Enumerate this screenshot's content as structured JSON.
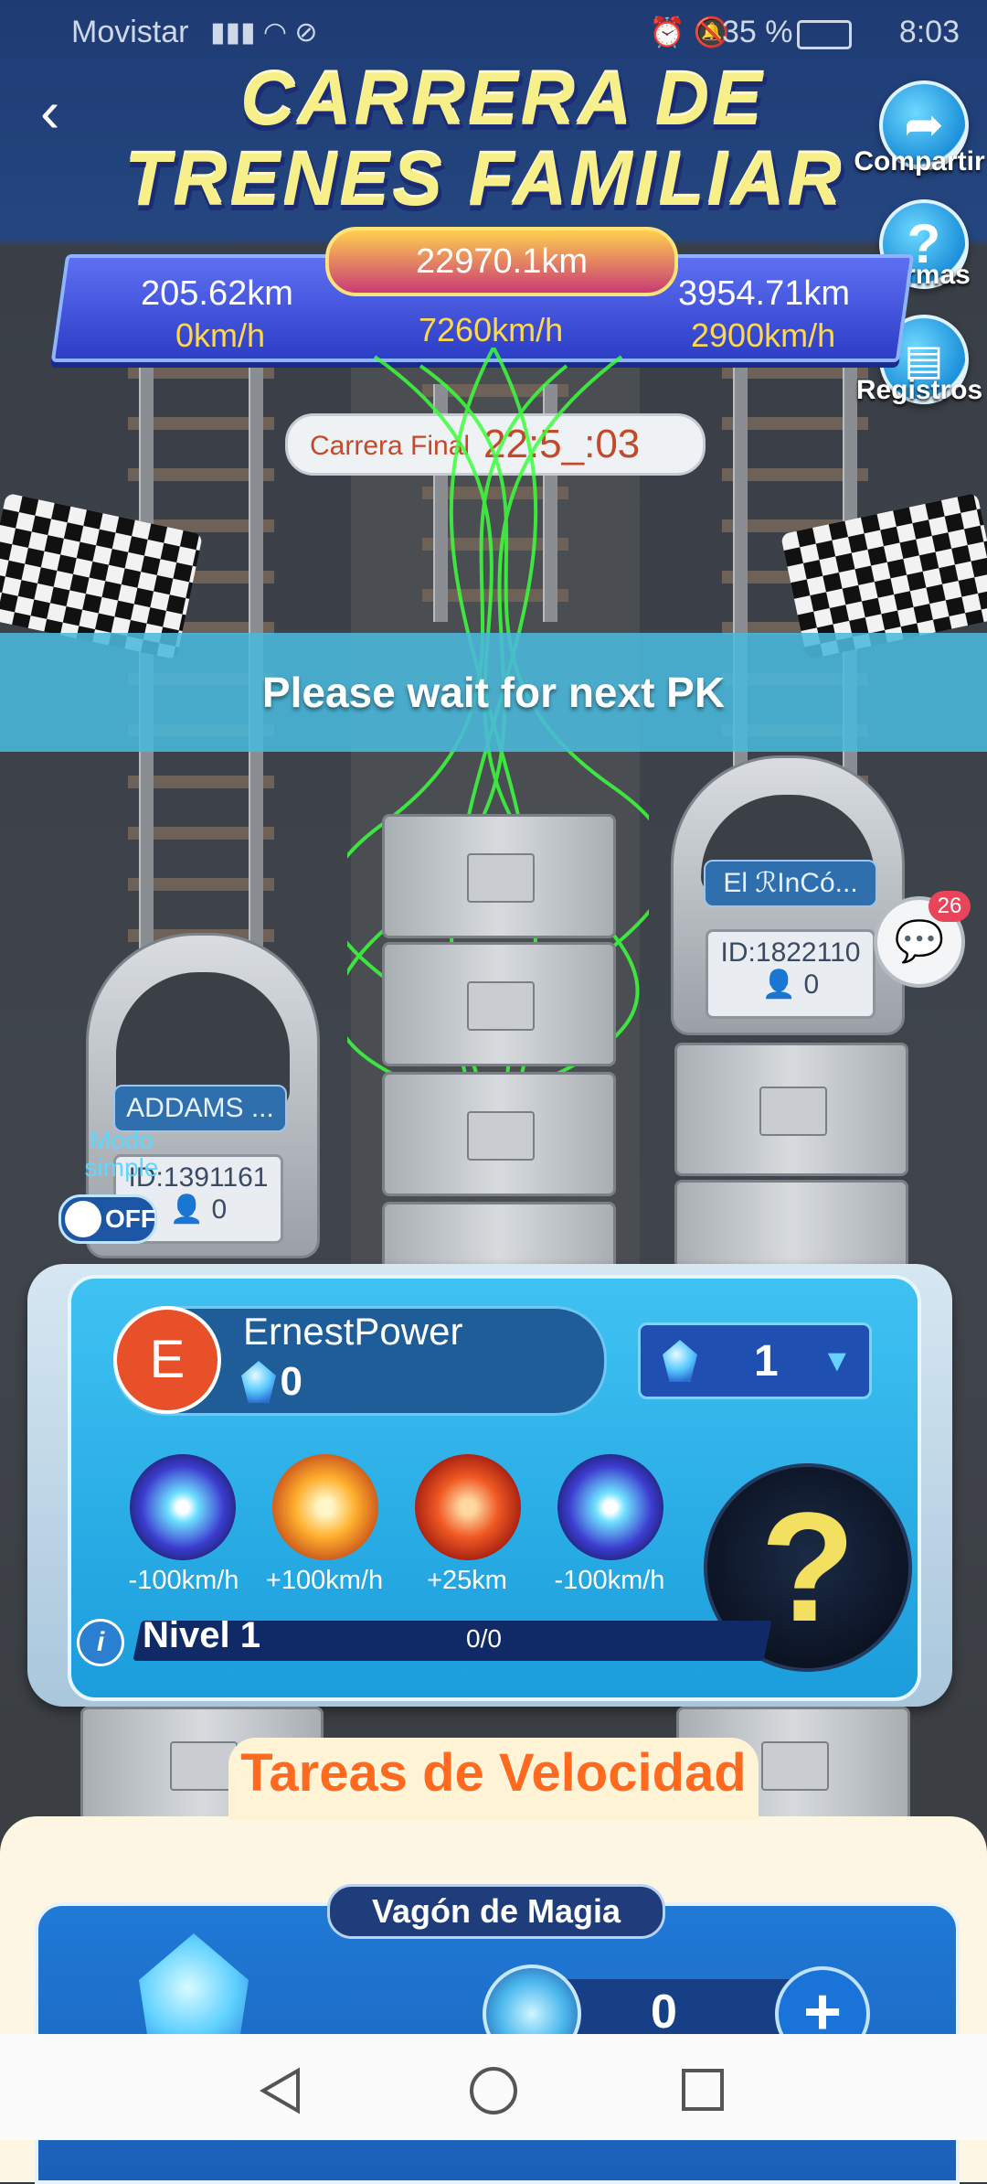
{
  "status_bar": {
    "carrier": "Movistar",
    "battery": "35 %",
    "time": "8:03"
  },
  "header": {
    "title_line1": "CARRERA DE",
    "title_line2": "TRENES FAMILIAR"
  },
  "side_buttons": {
    "share": "Compartir",
    "rules": "Normas",
    "records": "Registros"
  },
  "race": {
    "total_distance": "22970.1km",
    "left_distance": "205.62km",
    "left_speed": "0km/h",
    "center_speed": "7260km/h",
    "right_distance": "3954.71km",
    "right_speed": "2900km/h",
    "final_label": "Carrera Final",
    "final_timer": "22:5_:03",
    "wait_message": "Please wait for next PK"
  },
  "trains": {
    "left": {
      "name": "ADDAMS ...",
      "id": "ID:1391161",
      "members": "0"
    },
    "right": {
      "name": "El ℛInCó...",
      "id": "ID:1822110",
      "members": "0"
    }
  },
  "chat": {
    "badge_count": "26"
  },
  "simple_mode": {
    "label": "Modo simple",
    "toggle": "OFF"
  },
  "user": {
    "avatar_letter": "E",
    "name": "ErnestPower",
    "gems": "0",
    "gem_select_value": "1",
    "skills": [
      {
        "label": "-100km/h",
        "color": "#4a3fd6"
      },
      {
        "label": "+100km/h",
        "color": "#f0a020"
      },
      {
        "label": "+25km",
        "color": "#e0461e"
      },
      {
        "label": "-100km/h",
        "color": "#4a3fd6"
      }
    ],
    "level_label": "Nivel 1",
    "level_progress": "0/0",
    "mystery_symbol": "?"
  },
  "tasks": {
    "title": "Tareas de Velocidad",
    "magic_wagon": "Vagón de Magia",
    "magic_value": "0"
  }
}
